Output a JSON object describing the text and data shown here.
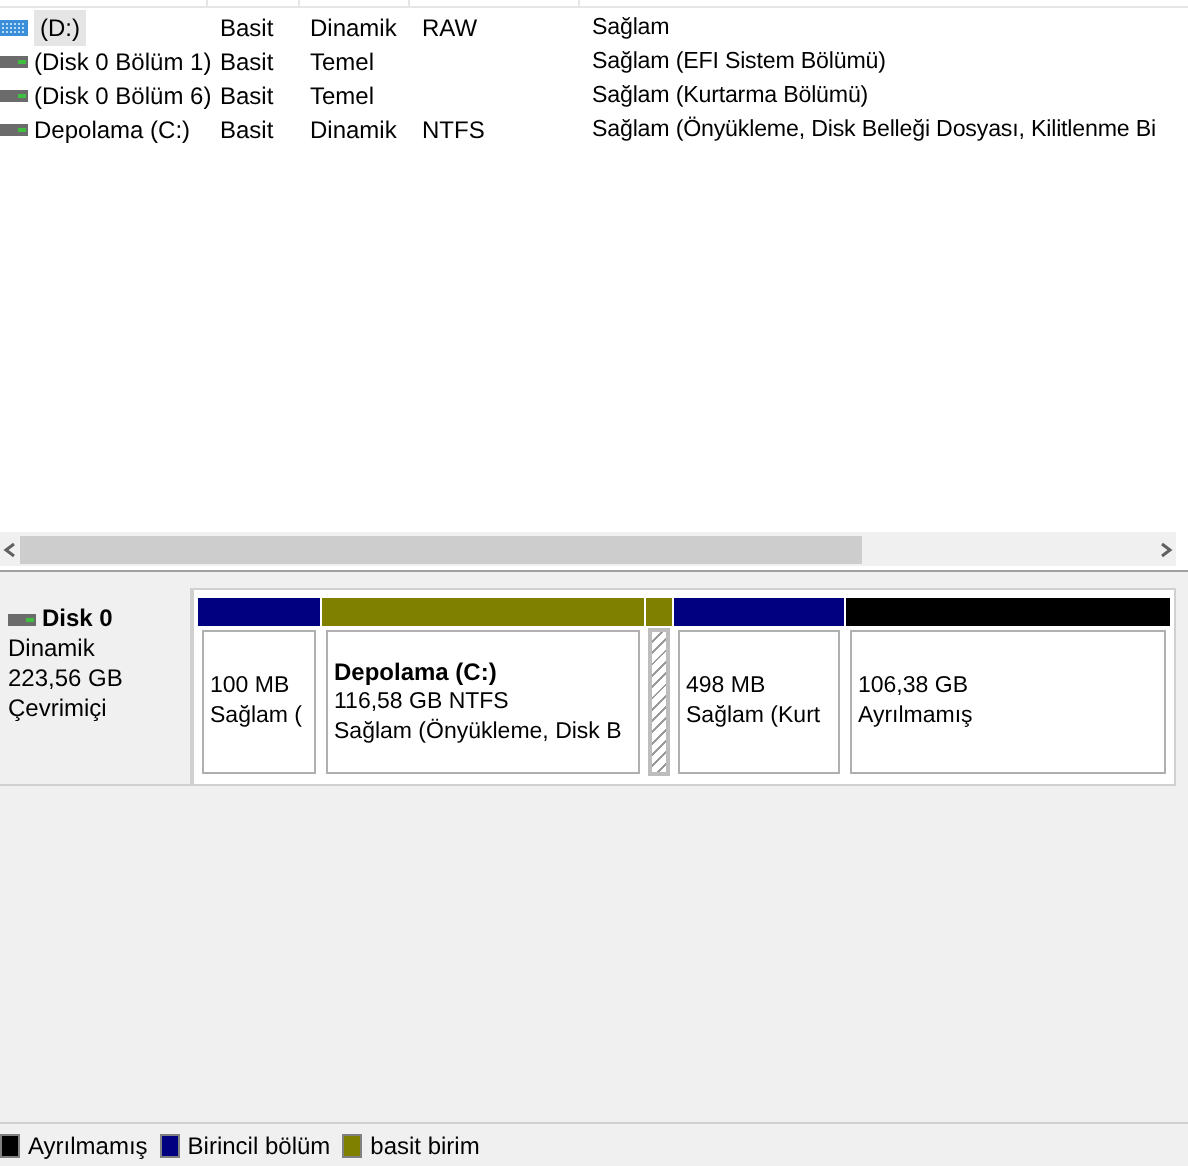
{
  "volumes": [
    {
      "name": "(D:)",
      "kind": "dynamic",
      "selected": true,
      "layout": "Basit",
      "type": "Dinamik",
      "file_system": "RAW",
      "status": "Sağlam"
    },
    {
      "name": "(Disk 0 Bölüm 1)",
      "kind": "basic",
      "selected": false,
      "layout": "Basit",
      "type": "Temel",
      "status": "Sağlam (EFI Sistem Bölümü)"
    },
    {
      "name": "(Disk 0 Bölüm 6)",
      "kind": "basic",
      "selected": false,
      "layout": "Basit",
      "type": "Temel",
      "status": "Sağlam (Kurtarma Bölümü)"
    },
    {
      "name": "Depolama (C:)",
      "kind": "basic",
      "selected": false,
      "layout": "Basit",
      "type": "Dinamik",
      "file_system": "NTFS",
      "status": "Sağlam (Önyükleme, Disk Belleği Dosyası, Kilitlenme Bi"
    }
  ],
  "disk": {
    "name": "Disk 0",
    "type": "Dinamik",
    "size": "223,56 GB",
    "state": "Çevrimiçi",
    "partitions": [
      {
        "color": "#000080",
        "selected": false,
        "lines": [
          "100 MB",
          "Sağlam ("
        ]
      },
      {
        "color": "#808000",
        "selected": false,
        "title": "Depolama  (C:)",
        "lines": [
          "116,58 GB NTFS",
          "Sağlam (Önyükleme, Disk B"
        ]
      },
      {
        "color": "#808000",
        "selected": true
      },
      {
        "color": "#000080",
        "selected": false,
        "lines": [
          "498 MB",
          "Sağlam (Kurt"
        ]
      },
      {
        "color": "#000000",
        "selected": false,
        "lines": [
          "106,38 GB",
          "Ayrılmamış"
        ]
      }
    ]
  },
  "legend": [
    {
      "color": "#000000",
      "label": "Ayrılmamış"
    },
    {
      "color": "#000080",
      "label": "Birincil bölüm"
    },
    {
      "color": "#808000",
      "label": "basit birim"
    }
  ]
}
